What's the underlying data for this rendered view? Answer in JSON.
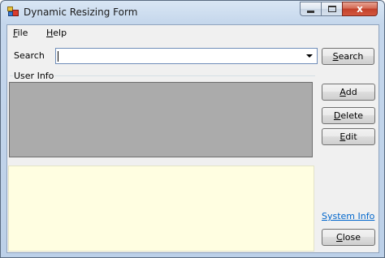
{
  "window": {
    "title": "Dynamic Resizing Form",
    "close_glyph": "x"
  },
  "menu": {
    "file_accel": "F",
    "file_rest": "ile",
    "help_accel": "H",
    "help_rest": "elp"
  },
  "search": {
    "label": "Search",
    "value": "",
    "button_accel": "S",
    "button_rest": "earch"
  },
  "user_info": {
    "label": "User Info"
  },
  "actions": {
    "add_accel": "A",
    "add_rest": "dd",
    "delete_accel": "D",
    "delete_rest": "elete",
    "edit_accel": "E",
    "edit_rest": "dit",
    "close_accel": "C",
    "close_rest": "lose"
  },
  "links": {
    "system_info": "System Info"
  },
  "colors": {
    "gray_panel": "#ababab",
    "yellow_panel": "#fffee1",
    "link": "#0066cc"
  }
}
